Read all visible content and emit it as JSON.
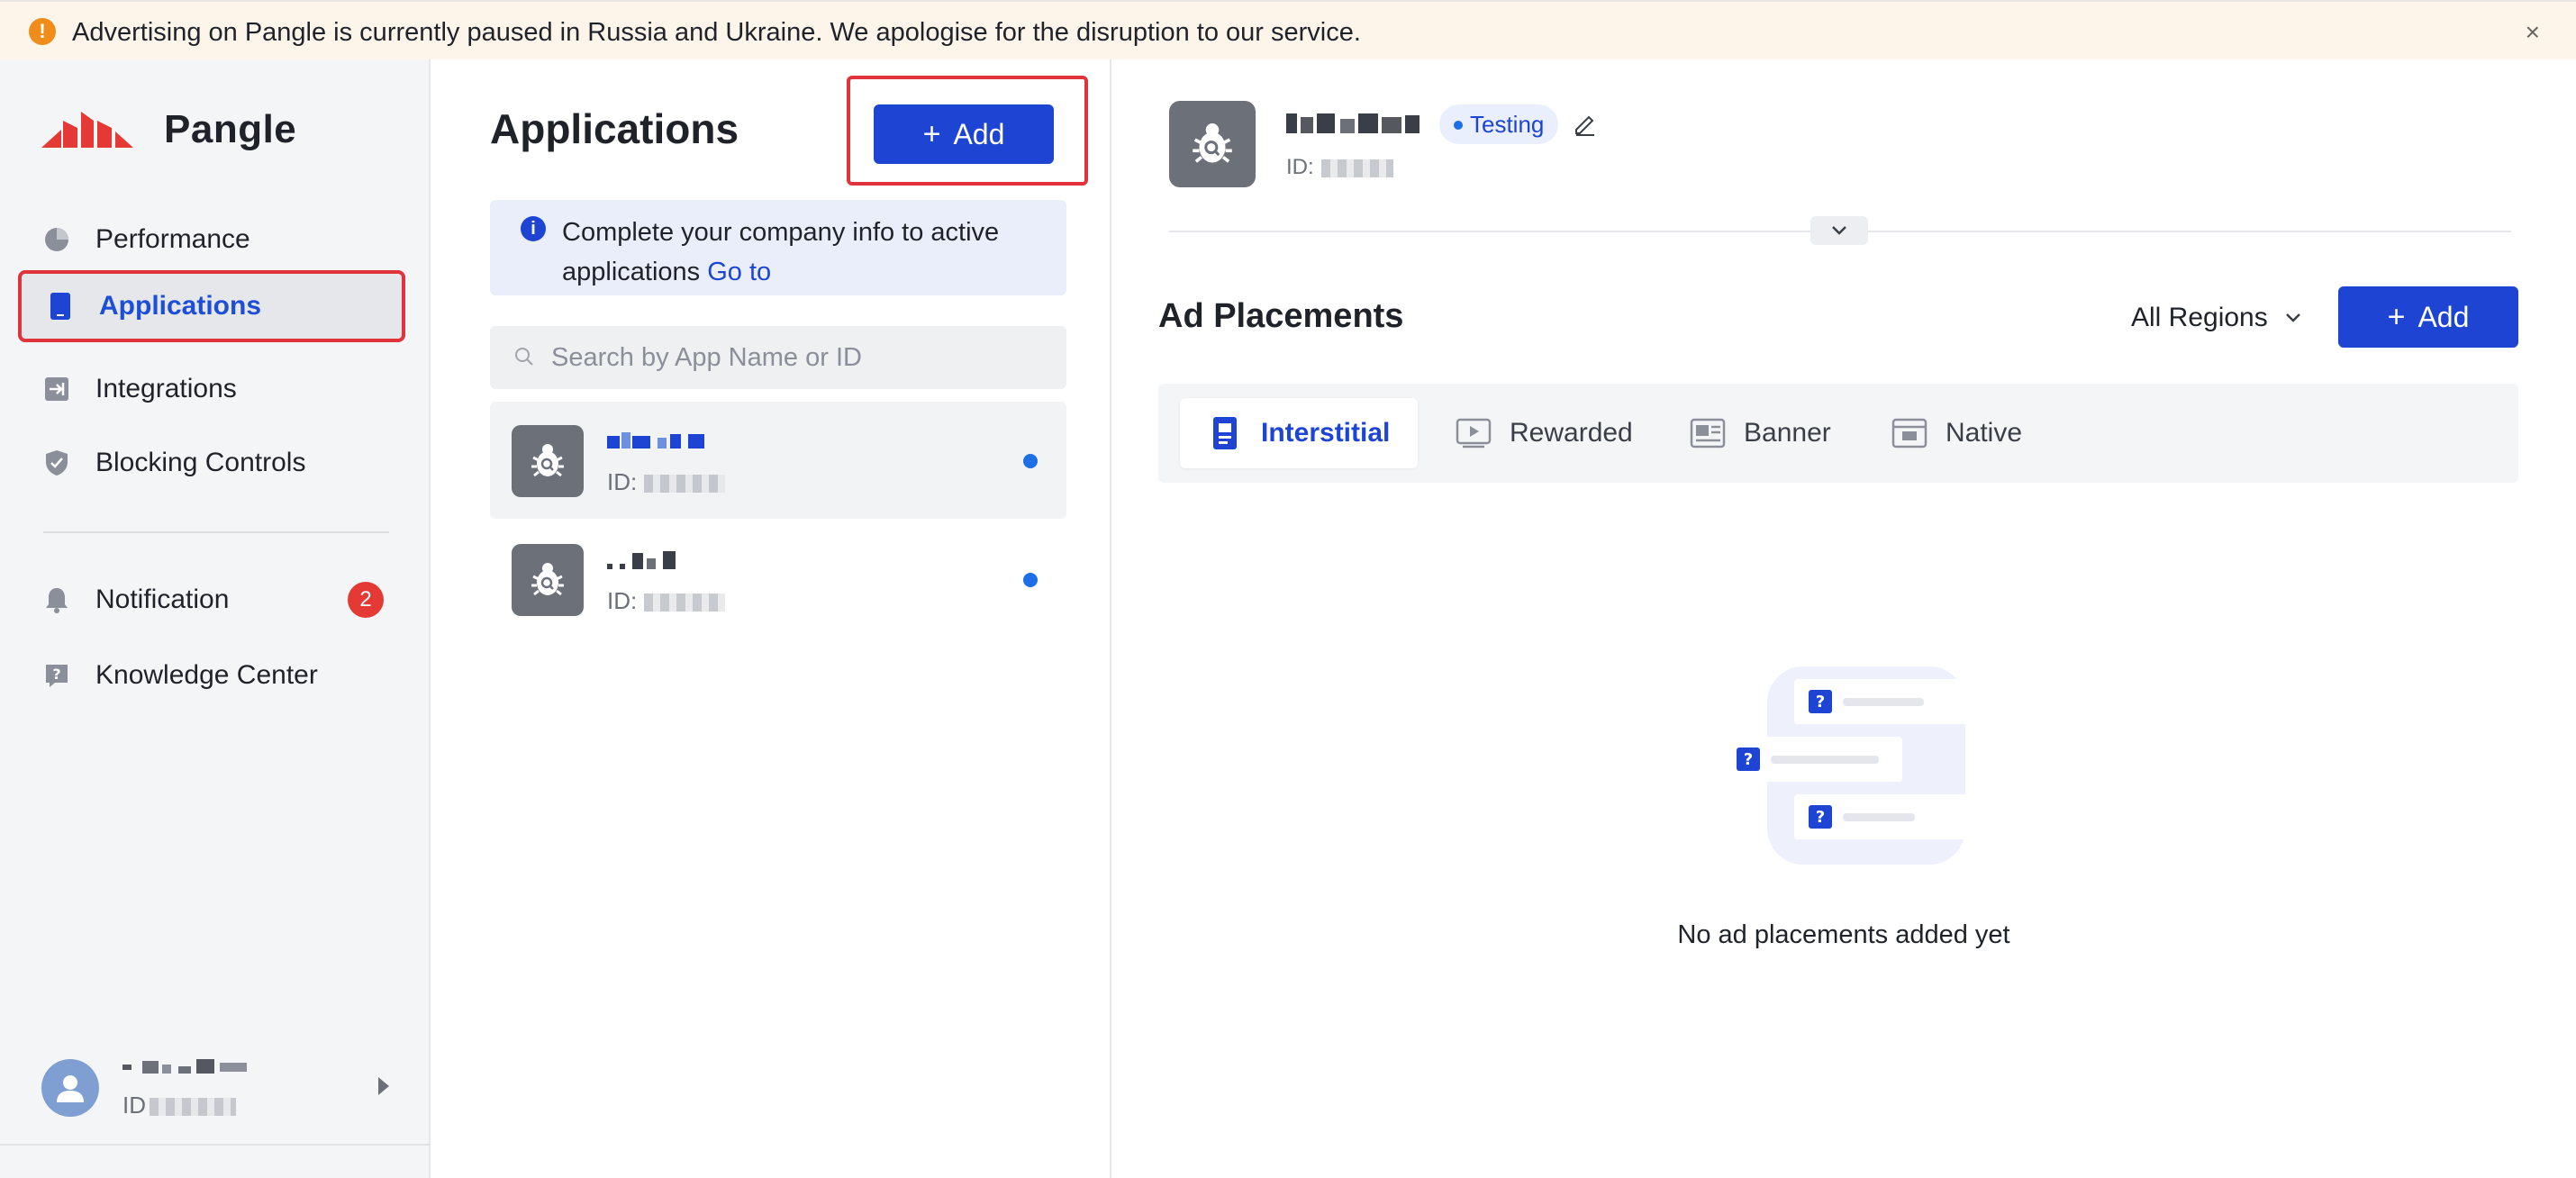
{
  "banner": {
    "text": "Advertising on Pangle is currently paused in Russia and Ukraine. We apologise for the disruption to our service.",
    "close": "×",
    "warn": "!"
  },
  "brand": {
    "name": "Pangle",
    "accent": "#e53935",
    "primary": "#1e44d3"
  },
  "sidebar": {
    "items": [
      {
        "label": "Performance",
        "icon": "pie-chart-icon"
      },
      {
        "label": "Applications",
        "icon": "phone-icon",
        "active": true
      },
      {
        "label": "Integrations",
        "icon": "integration-icon"
      },
      {
        "label": "Blocking Controls",
        "icon": "shield-icon"
      }
    ],
    "secondary": [
      {
        "label": "Notification",
        "icon": "bell-icon",
        "badge": "2"
      },
      {
        "label": "Knowledge Center",
        "icon": "help-icon"
      }
    ],
    "user": {
      "id_label": "ID"
    }
  },
  "apps": {
    "title": "Applications",
    "add_label": "Add",
    "info": {
      "text": "Complete your company info to active applications",
      "link": "Go to"
    },
    "search": {
      "placeholder": "Search by App Name or ID"
    },
    "rows": [
      {
        "id_label": "ID:",
        "selected": true
      },
      {
        "id_label": "ID:",
        "selected": false
      }
    ]
  },
  "detail": {
    "status": "Testing",
    "id_label": "ID:",
    "placements_title": "Ad Placements",
    "regions_label": "All Regions",
    "add_label": "Add",
    "tabs": [
      {
        "label": "Interstitial",
        "icon": "interstitial-icon",
        "active": true
      },
      {
        "label": "Rewarded",
        "icon": "rewarded-icon"
      },
      {
        "label": "Banner",
        "icon": "banner-icon"
      },
      {
        "label": "Native",
        "icon": "native-icon"
      }
    ],
    "empty_text": "No ad placements added yet"
  }
}
